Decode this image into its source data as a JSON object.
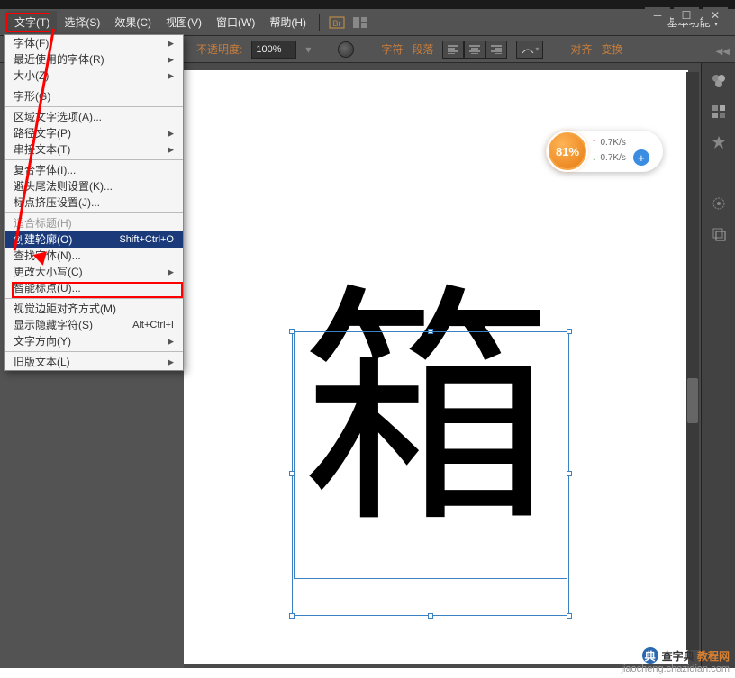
{
  "menubar": {
    "items": [
      {
        "label": "文字(T)",
        "active": true
      },
      {
        "label": "选择(S)"
      },
      {
        "label": "效果(C)"
      },
      {
        "label": "视图(V)"
      },
      {
        "label": "窗口(W)"
      },
      {
        "label": "帮助(H)"
      }
    ],
    "workspace": "基本功能"
  },
  "optionsbar": {
    "opacity_label": "不透明度:",
    "opacity_value": "100%",
    "char_label": "字符",
    "para_label": "段落",
    "align_label": "对齐",
    "transform_label": "变换"
  },
  "dropdown": {
    "items": [
      {
        "label": "字体(F)",
        "arrow": true
      },
      {
        "label": "最近使用的字体(R)",
        "arrow": true
      },
      {
        "label": "大小(Z)",
        "arrow": true
      },
      {
        "type": "divider"
      },
      {
        "label": "字形(G)"
      },
      {
        "type": "divider"
      },
      {
        "label": "区域文字选项(A)..."
      },
      {
        "label": "路径文字(P)",
        "arrow": true
      },
      {
        "label": "串接文本(T)",
        "arrow": true
      },
      {
        "type": "divider"
      },
      {
        "label": "复合字体(I)..."
      },
      {
        "label": "避头尾法则设置(K)..."
      },
      {
        "label": "标点挤压设置(J)..."
      },
      {
        "type": "divider"
      },
      {
        "label": "适合标题(H)",
        "disabled": true
      },
      {
        "label": "创建轮廓(O)",
        "shortcut": "Shift+Ctrl+O",
        "selected": true
      },
      {
        "label": "查找字体(N)..."
      },
      {
        "label": "更改大小写(C)",
        "arrow": true
      },
      {
        "label": "智能标点(U)..."
      },
      {
        "type": "divider"
      },
      {
        "label": "视觉边距对齐方式(M)"
      },
      {
        "label": "显示隐藏字符(S)",
        "shortcut": "Alt+Ctrl+I"
      },
      {
        "label": "文字方向(Y)",
        "arrow": true
      },
      {
        "type": "divider"
      },
      {
        "label": "旧版文本(L)",
        "arrow": true
      }
    ]
  },
  "canvas": {
    "glyph": "箱"
  },
  "badge": {
    "percent": "81%",
    "up_speed": "0.7K/s",
    "down_speed": "0.7K/s"
  },
  "watermark": {
    "brand1": "查字典",
    "brand2": "教程网",
    "url": "jiaocheng.chazidian.com"
  }
}
